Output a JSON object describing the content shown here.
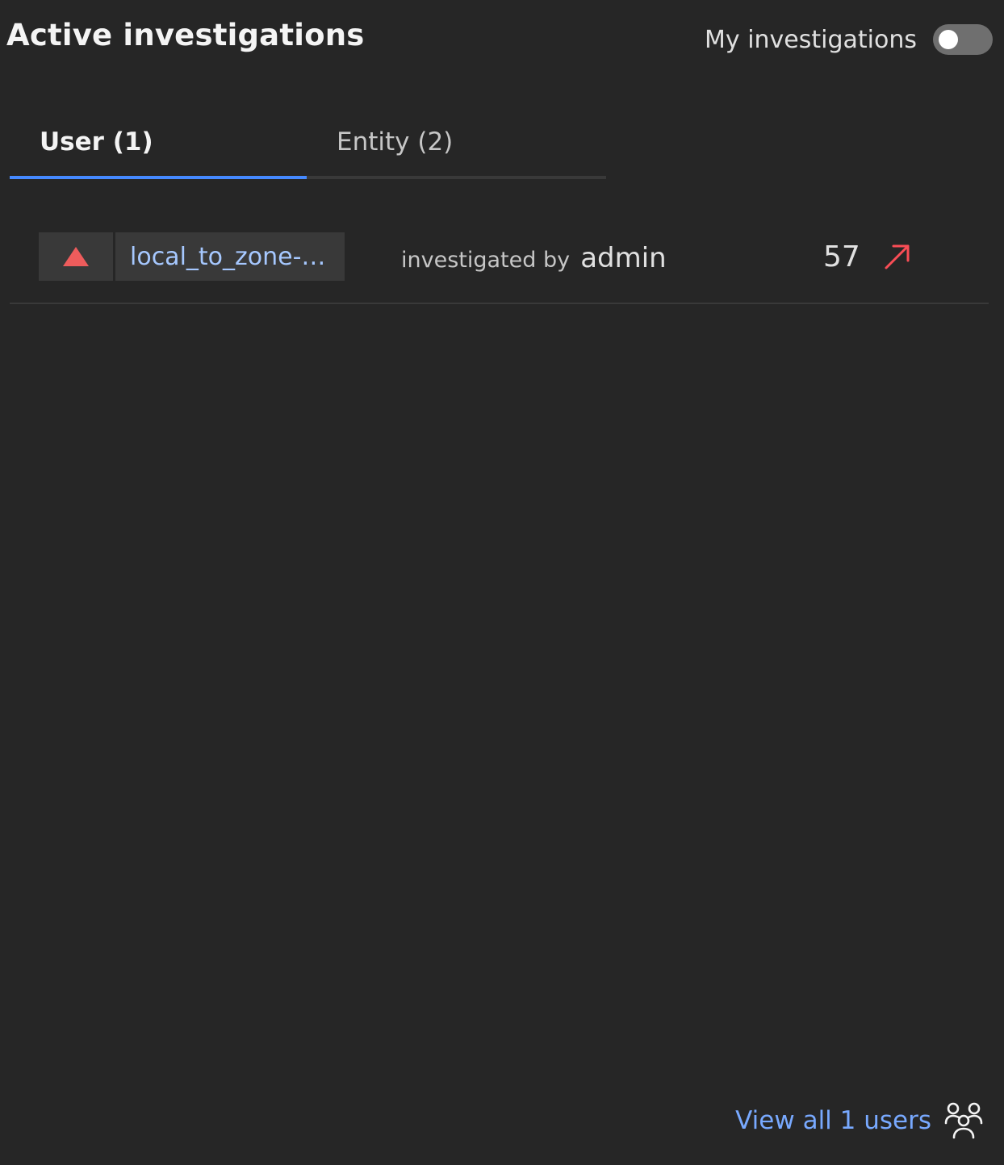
{
  "header": {
    "title": "Active investigations",
    "toggle_label": "My investigations",
    "toggle_on": false
  },
  "tabs": [
    {
      "label": "User (1)",
      "active": true
    },
    {
      "label": "Entity (2)",
      "active": false
    }
  ],
  "rows": [
    {
      "risk_icon": "triangle-up-icon",
      "risk_color": "#ee5c5c",
      "name": "local_to_zone-…",
      "investigated_prefix": "investigated by",
      "investigated_by": "admin",
      "score": "57",
      "trend_icon": "arrow-up-right-icon",
      "trend_color": "#fa4d56"
    }
  ],
  "footer": {
    "view_all_label": "View all 1 users",
    "icon": "user-group-icon"
  },
  "colors": {
    "background": "#262626",
    "accent": "#4589ff",
    "link": "#a6c8ff"
  }
}
